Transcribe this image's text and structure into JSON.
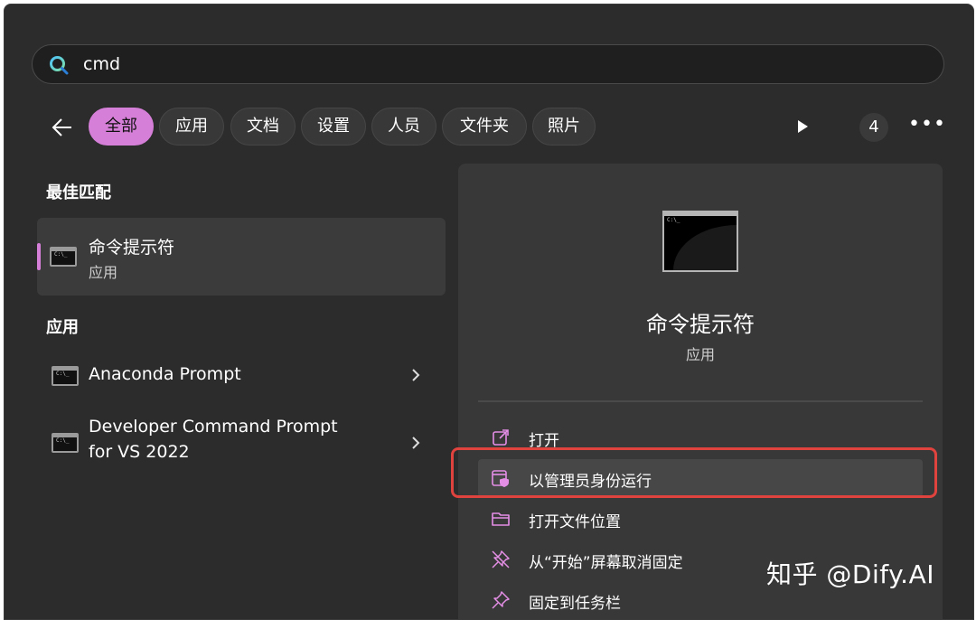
{
  "search": {
    "value": "cmd"
  },
  "filters": {
    "chips": [
      "全部",
      "应用",
      "文档",
      "设置",
      "人员",
      "文件夹",
      "照片"
    ],
    "active_index": 0,
    "result_count": "4"
  },
  "left": {
    "best_match_heading": "最佳匹配",
    "best_match": {
      "title": "命令提示符",
      "subtitle": "应用"
    },
    "apps_heading": "应用",
    "apps": [
      {
        "title": "Anaconda Prompt"
      },
      {
        "title_line1": "Developer Command Prompt",
        "title_line2": "for VS 2022"
      }
    ]
  },
  "details": {
    "title": "命令提示符",
    "subtitle": "应用",
    "actions": [
      {
        "label": "打开",
        "icon": "open-external-icon"
      },
      {
        "label": "以管理员身份运行",
        "icon": "run-as-admin-shield-icon"
      },
      {
        "label": "打开文件位置",
        "icon": "folder-icon"
      },
      {
        "label": "从“开始”屏幕取消固定",
        "icon": "unpin-icon"
      },
      {
        "label": "固定到任务栏",
        "icon": "pin-icon"
      }
    ]
  },
  "watermark": "知乎 @Dify.AI",
  "colors": {
    "accent": "#d67fd8",
    "highlight_border": "#e0433e",
    "background": "#2c2c2c",
    "panel": "#383838"
  }
}
